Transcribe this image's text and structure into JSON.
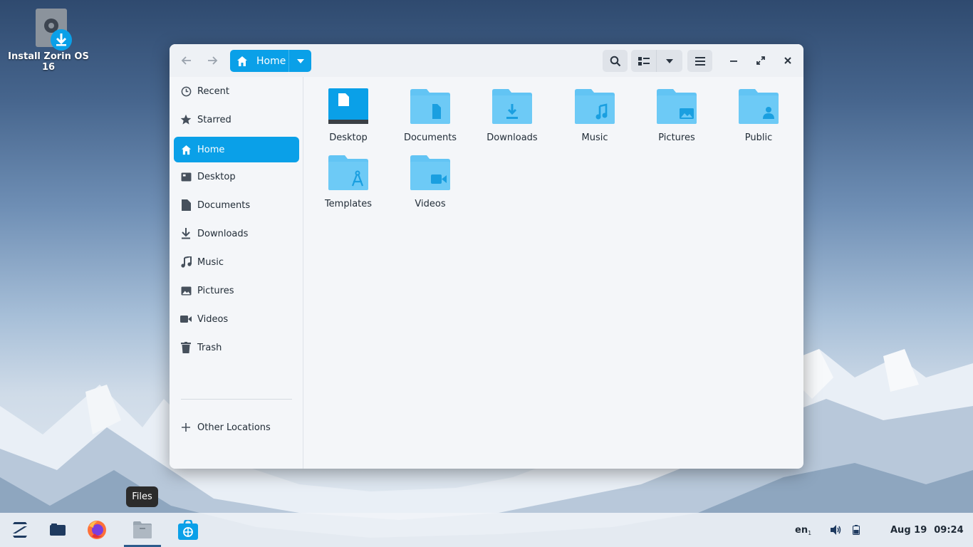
{
  "desktop": {
    "icon_label": "Install Zorin OS 16"
  },
  "window": {
    "path_label": "Home",
    "sidebar": {
      "items": [
        {
          "label": "Recent",
          "icon": "clock-icon"
        },
        {
          "label": "Starred",
          "icon": "star-icon"
        },
        {
          "label": "Home",
          "icon": "home-icon",
          "active": true
        },
        {
          "label": "Desktop",
          "icon": "desktop-icon"
        },
        {
          "label": "Documents",
          "icon": "document-icon"
        },
        {
          "label": "Downloads",
          "icon": "download-icon"
        },
        {
          "label": "Music",
          "icon": "music-icon"
        },
        {
          "label": "Pictures",
          "icon": "picture-icon"
        },
        {
          "label": "Videos",
          "icon": "video-icon"
        },
        {
          "label": "Trash",
          "icon": "trash-icon"
        }
      ],
      "other_locations": "Other Locations"
    },
    "files": [
      {
        "label": "Desktop",
        "icon": "desktop-folder-icon"
      },
      {
        "label": "Documents",
        "icon": "documents-folder-icon"
      },
      {
        "label": "Downloads",
        "icon": "downloads-folder-icon"
      },
      {
        "label": "Music",
        "icon": "music-folder-icon"
      },
      {
        "label": "Pictures",
        "icon": "pictures-folder-icon"
      },
      {
        "label": "Public",
        "icon": "public-folder-icon"
      },
      {
        "label": "Templates",
        "icon": "templates-folder-icon"
      },
      {
        "label": "Videos",
        "icon": "videos-folder-icon"
      }
    ]
  },
  "tooltip": "Files",
  "taskbar": {
    "keyboard_layout": "en",
    "keyboard_sub": "1",
    "date": "Aug 19",
    "time": "09:24"
  },
  "colors": {
    "accent": "#0aa0e8",
    "folder": "#62c4f4",
    "folder_dark": "#1a9fe0"
  }
}
